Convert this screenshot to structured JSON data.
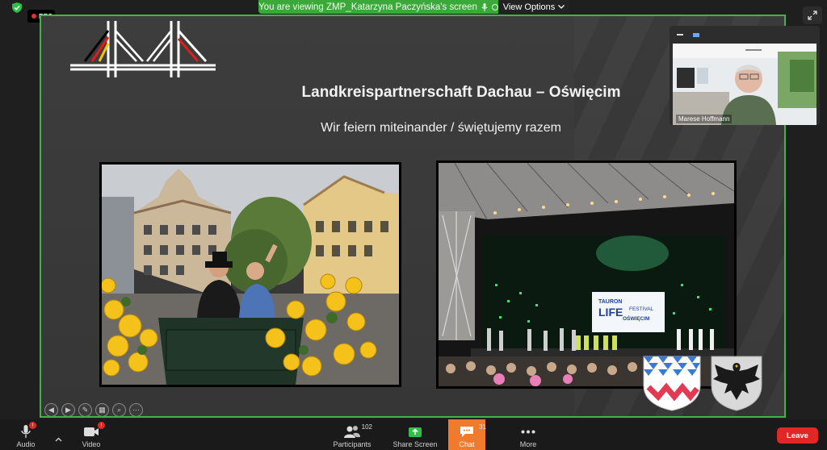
{
  "top": {
    "rec_label": "REC",
    "banner_text": "You are viewing ZMP_Katarzyna Paczyńska's screen",
    "view_options_label": "View Options"
  },
  "slide": {
    "title": "Landkreispartnerschaft Dachau – Oświęcim",
    "subtitle": "Wir feiern miteinander / świętujemy razem",
    "festival_sign": {
      "line1": "TAURON",
      "line2": "LIFE",
      "line3": "FESTIVAL",
      "line4": "OŚWIĘCIM"
    }
  },
  "video": {
    "participant_name": "Marese Hoffmann"
  },
  "toolbar": {
    "audio_label": "Audio",
    "audio_badge": "!",
    "video_label": "Video",
    "video_badge": "!",
    "participants_label": "Participants",
    "participants_count": "102",
    "share_label": "Share Screen",
    "chat_label": "Chat",
    "chat_count": "31",
    "more_label": "More",
    "leave_label": "Leave"
  },
  "colors": {
    "share_border": "#41b544",
    "banner": "#3aa93a",
    "chat_active": "#f07b2c",
    "leave": "#e02828"
  }
}
